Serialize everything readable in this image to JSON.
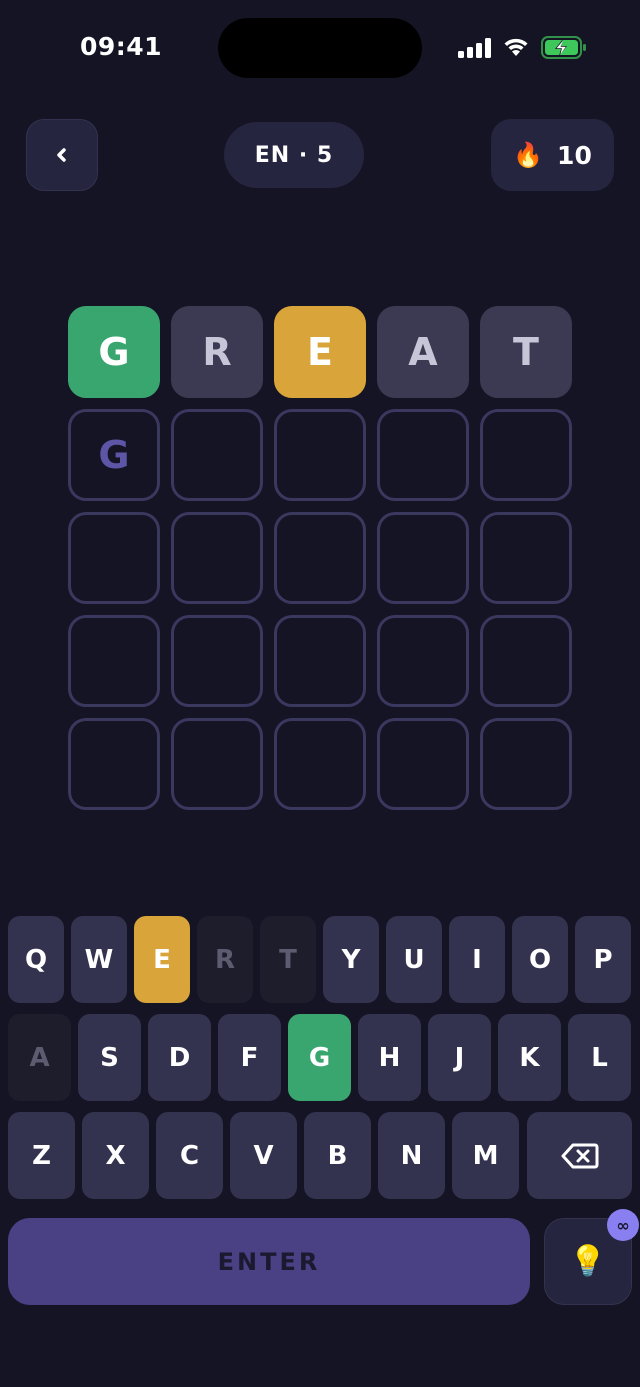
{
  "status_bar": {
    "time": "09:41"
  },
  "header": {
    "mode_label": "EN · 5",
    "streak_icon": "🔥",
    "streak_count": "10"
  },
  "board": {
    "rows": [
      [
        {
          "letter": "G",
          "state": "correct"
        },
        {
          "letter": "R",
          "state": "absent"
        },
        {
          "letter": "E",
          "state": "present"
        },
        {
          "letter": "A",
          "state": "absent"
        },
        {
          "letter": "T",
          "state": "absent"
        }
      ],
      [
        {
          "letter": "G",
          "state": "typing"
        },
        {
          "letter": "",
          "state": "empty"
        },
        {
          "letter": "",
          "state": "empty"
        },
        {
          "letter": "",
          "state": "empty"
        },
        {
          "letter": "",
          "state": "empty"
        }
      ],
      [
        {
          "letter": "",
          "state": "empty"
        },
        {
          "letter": "",
          "state": "empty"
        },
        {
          "letter": "",
          "state": "empty"
        },
        {
          "letter": "",
          "state": "empty"
        },
        {
          "letter": "",
          "state": "empty"
        }
      ],
      [
        {
          "letter": "",
          "state": "empty"
        },
        {
          "letter": "",
          "state": "empty"
        },
        {
          "letter": "",
          "state": "empty"
        },
        {
          "letter": "",
          "state": "empty"
        },
        {
          "letter": "",
          "state": "empty"
        }
      ],
      [
        {
          "letter": "",
          "state": "empty"
        },
        {
          "letter": "",
          "state": "empty"
        },
        {
          "letter": "",
          "state": "empty"
        },
        {
          "letter": "",
          "state": "empty"
        },
        {
          "letter": "",
          "state": "empty"
        }
      ]
    ]
  },
  "keyboard": {
    "rows": [
      [
        {
          "label": "Q",
          "state": "default"
        },
        {
          "label": "W",
          "state": "default"
        },
        {
          "label": "E",
          "state": "present"
        },
        {
          "label": "R",
          "state": "absent"
        },
        {
          "label": "T",
          "state": "absent"
        },
        {
          "label": "Y",
          "state": "default"
        },
        {
          "label": "U",
          "state": "default"
        },
        {
          "label": "I",
          "state": "default"
        },
        {
          "label": "O",
          "state": "default"
        },
        {
          "label": "P",
          "state": "default"
        }
      ],
      [
        {
          "label": "A",
          "state": "absent"
        },
        {
          "label": "S",
          "state": "default"
        },
        {
          "label": "D",
          "state": "default"
        },
        {
          "label": "F",
          "state": "default"
        },
        {
          "label": "G",
          "state": "correct"
        },
        {
          "label": "H",
          "state": "default"
        },
        {
          "label": "J",
          "state": "default"
        },
        {
          "label": "K",
          "state": "default"
        },
        {
          "label": "L",
          "state": "default"
        }
      ],
      [
        {
          "label": "Z",
          "state": "default"
        },
        {
          "label": "X",
          "state": "default"
        },
        {
          "label": "C",
          "state": "default"
        },
        {
          "label": "V",
          "state": "default"
        },
        {
          "label": "B",
          "state": "default"
        },
        {
          "label": "N",
          "state": "default"
        },
        {
          "label": "M",
          "state": "default"
        }
      ]
    ],
    "backspace_icon": "backspace-icon",
    "enter_label": "ENTER",
    "hint_icon": "💡",
    "hint_badge": "∞"
  },
  "colors": {
    "background": "#151424",
    "correct": "#3aa66f",
    "present": "#d9a53a",
    "absent": "#3b3a52",
    "accent": "#4a4084"
  }
}
